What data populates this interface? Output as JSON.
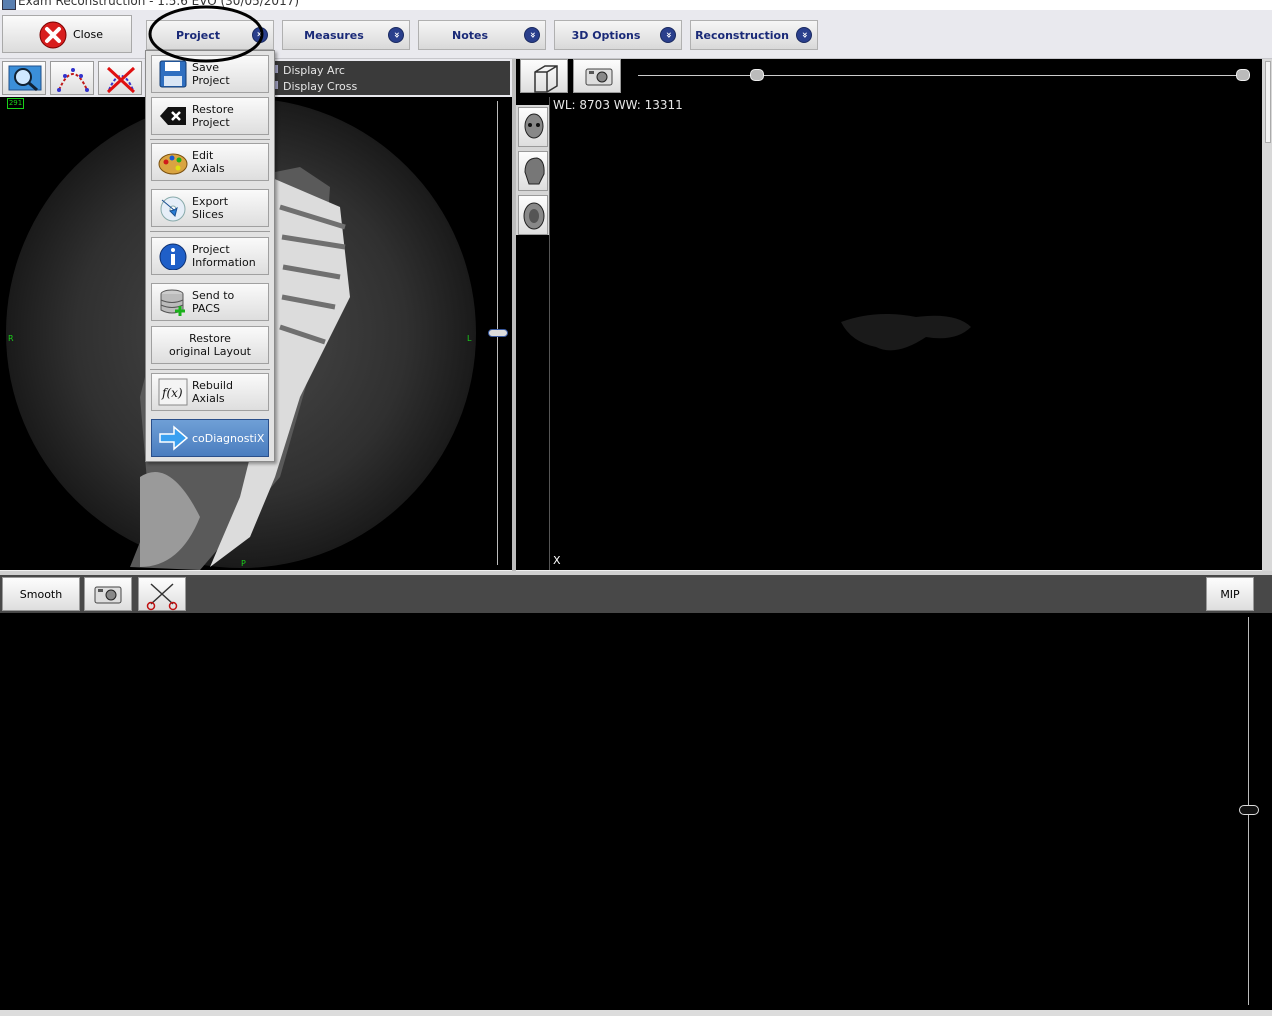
{
  "window": {
    "title": "Exam Reconstruction - 1.5.6 EVO (30/05/2017)"
  },
  "toolbar": {
    "close_label": "Close",
    "tabs": [
      {
        "label": "Project"
      },
      {
        "label": "Measures"
      },
      {
        "label": "Notes"
      },
      {
        "label": "3D Options"
      },
      {
        "label": "Reconstruction"
      }
    ]
  },
  "project_menu": {
    "items": [
      {
        "line1": "Save",
        "line2": "Project",
        "icon": "floppy-disk-icon"
      },
      {
        "line1": "Restore",
        "line2": "Project",
        "icon": "backspace-icon"
      },
      {
        "line1": "Edit",
        "line2": "Axials",
        "icon": "palette-icon"
      },
      {
        "line1": "Export",
        "line2": "Slices",
        "icon": "export-disc-icon"
      },
      {
        "line1": "Project",
        "line2": "Information",
        "icon": "info-icon"
      },
      {
        "line1": "Send to",
        "line2": "PACS",
        "icon": "database-add-icon"
      },
      {
        "line1": "Restore",
        "line2": "original Layout",
        "icon": ""
      },
      {
        "line1": "Rebuild",
        "line2": "Axials",
        "icon": "function-fx-icon"
      },
      {
        "line1": "coDiagnostiX",
        "line2": "",
        "icon": "arrow-right-icon"
      }
    ]
  },
  "left_view": {
    "options": [
      "Display Arc",
      "Display Cross"
    ],
    "slice_badge": "291",
    "label_r": "R",
    "label_l": "L",
    "label_p": "P"
  },
  "right_view": {
    "wl_ww": "WL: 8703 WW: 13311",
    "axis_label": "X"
  },
  "bottom_bar": {
    "smooth_label": "Smooth",
    "mip_label": "MIP"
  },
  "colors": {
    "tab_text": "#1a2a78",
    "accent": "#2a3f8c",
    "highlight": "#19d019"
  }
}
